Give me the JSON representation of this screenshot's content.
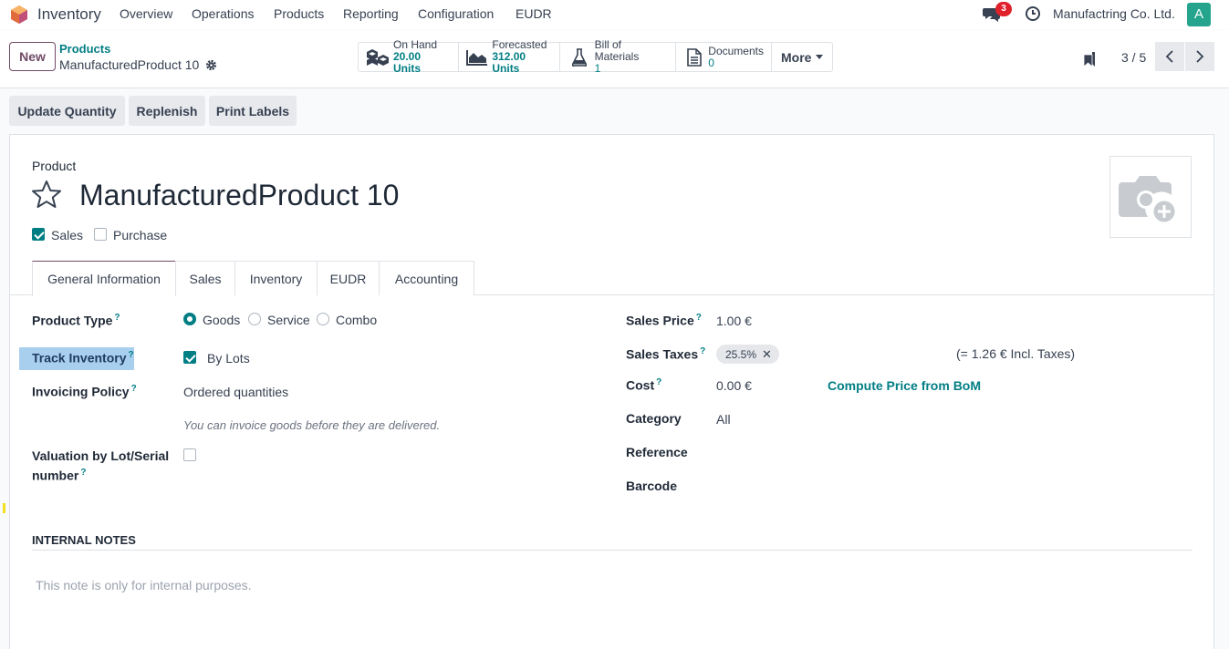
{
  "navbar": {
    "app_name": "Inventory",
    "menu": [
      "Overview",
      "Operations",
      "Products",
      "Reporting",
      "Configuration",
      "EUDR"
    ],
    "chat_badge": "3",
    "company": "Manufactring Co. Ltd.",
    "avatar_letter": "A"
  },
  "control": {
    "new_label": "New",
    "breadcrumb_parent": "Products",
    "breadcrumb_current": "ManufacturedProduct 10",
    "smart_buttons": [
      {
        "label": "On Hand",
        "value": "20.00 Units",
        "icon": "cubes-icon"
      },
      {
        "label": "Forecasted",
        "value": "312.00 Units",
        "icon": "area-chart-icon"
      },
      {
        "label": "Bill of Materials",
        "value": "1",
        "icon": "flask-icon"
      },
      {
        "label": "Documents",
        "value": "0",
        "icon": "document-icon"
      }
    ],
    "more_label": "More",
    "pager": "3 / 5"
  },
  "actions": {
    "update_qty": "Update Quantity",
    "replenish": "Replenish",
    "print_labels": "Print Labels"
  },
  "product": {
    "label": "Product",
    "name": "ManufacturedProduct 10",
    "sales_label": "Sales",
    "sales_checked": true,
    "purchase_label": "Purchase",
    "purchase_checked": false
  },
  "tabs": [
    "General Information",
    "Sales",
    "Inventory",
    "EUDR",
    "Accounting"
  ],
  "left_fields": {
    "product_type_label": "Product Type",
    "product_type_options": [
      "Goods",
      "Service",
      "Combo"
    ],
    "product_type_selected": "Goods",
    "track_inventory_label": "Track Inventory",
    "track_inventory_value": "By Lots",
    "invoicing_policy_label": "Invoicing Policy",
    "invoicing_policy_value": "Ordered quantities",
    "invoicing_hint": "You can invoice goods before they are delivered.",
    "valuation_label_1": "Valuation by Lot/Serial",
    "valuation_label_2": "number"
  },
  "right_fields": {
    "sales_price_label": "Sales Price",
    "sales_price_value": "1.00 €",
    "sales_taxes_label": "Sales Taxes",
    "sales_taxes_tag": "25.5%",
    "incl_taxes": "(= 1.26 € Incl. Taxes)",
    "cost_label": "Cost",
    "cost_value": "0.00 €",
    "compute_bom": "Compute Price from BoM",
    "category_label": "Category",
    "category_value": "All",
    "reference_label": "Reference",
    "barcode_label": "Barcode"
  },
  "notes": {
    "title": "INTERNAL NOTES",
    "placeholder": "This note is only for internal purposes."
  },
  "colors": {
    "brand": "#714b67",
    "accent": "#017e84",
    "highlight": "#a9cfef"
  }
}
